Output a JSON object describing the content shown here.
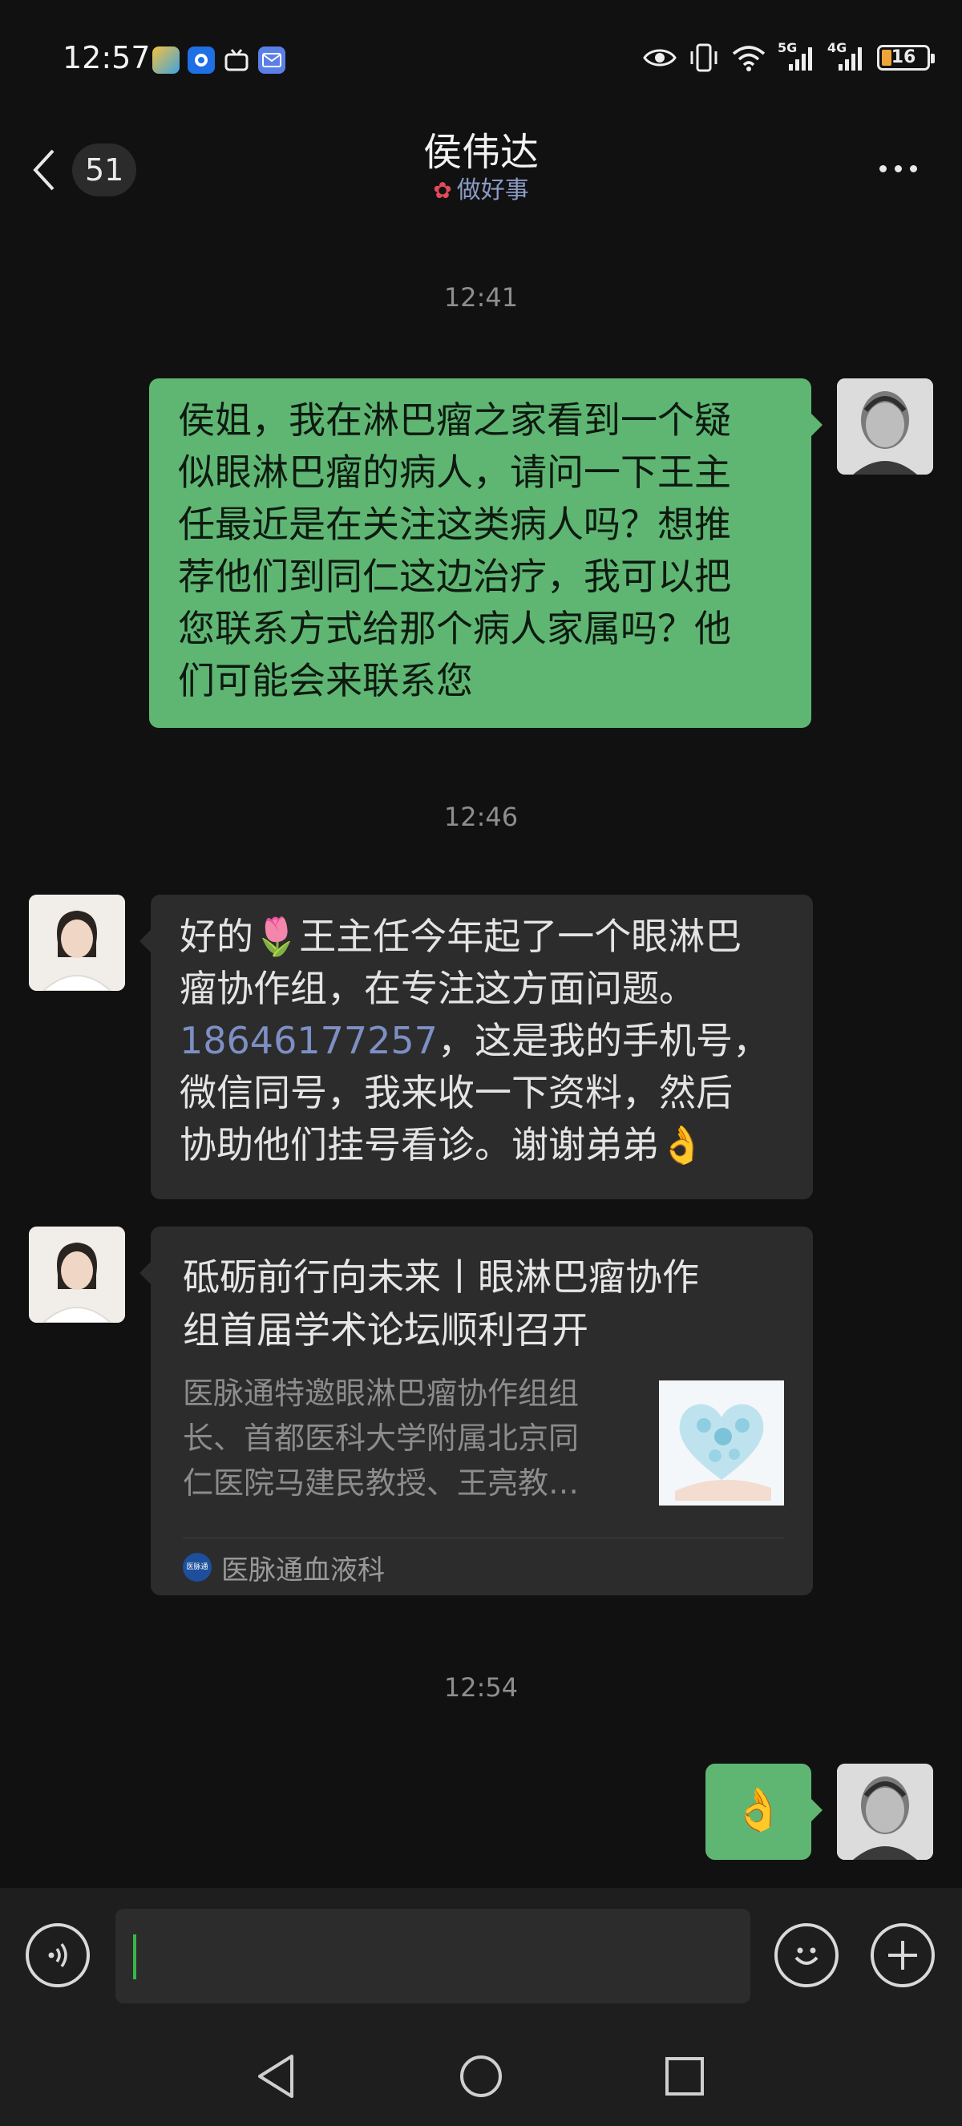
{
  "status_bar": {
    "time": "12:57",
    "battery_level": "16",
    "network_labels": [
      "5G",
      "4G"
    ],
    "icons": [
      "weather-app-icon",
      "browser-app-icon",
      "bilibili-app-icon",
      "mail-app-icon",
      "eye-icon",
      "vibrate-icon",
      "wifi-icon",
      "signal-5g-icon",
      "signal-4g-icon",
      "battery-icon"
    ]
  },
  "header": {
    "unread_count": "51",
    "contact_name": "侯伟达",
    "status_text": "做好事",
    "status_icon": "flower-icon"
  },
  "messages": [
    {
      "type": "timestamp",
      "text": "12:41"
    },
    {
      "type": "text",
      "sender": "self",
      "lines": [
        "侯姐，我在淋巴瘤之家看到一个疑",
        "似眼淋巴瘤的病人，请问一下王主",
        "任最近是在关注这类病人吗？想推",
        "荐他们到同仁这边治疗，我可以把",
        "您联系方式给那个病人家属吗？他",
        "们可能会来联系您"
      ]
    },
    {
      "type": "timestamp",
      "text": "12:46"
    },
    {
      "type": "text",
      "sender": "other",
      "line1_start": "好的",
      "line1_emoji": "🌷",
      "line1_end": "王主任今年起了一个眼淋巴",
      "line2": "瘤协作组，在专注这方面问题。",
      "phone": "18646177257",
      "line3_end": "，这是我的手机号，",
      "line4": "微信同号，我来收一下资料，然后",
      "line5": "协助他们挂号看诊。谢谢弟弟",
      "line5_emoji": "👌"
    },
    {
      "type": "link_card",
      "sender": "other",
      "title_lines": [
        "砥砺前行向未来丨眼淋巴瘤协作",
        "组首届学术论坛顺利召开"
      ],
      "desc_lines": [
        "医脉通特邀眼淋巴瘤协作组组",
        "长、首都医科大学附属北京同",
        "仁医院马建民教授、王亮教…"
      ],
      "source": "医脉通血液科",
      "source_logo_text": "医脉通"
    },
    {
      "type": "timestamp",
      "text": "12:54"
    },
    {
      "type": "emoji",
      "sender": "self",
      "text": "👌"
    }
  ],
  "input_bar": {
    "value": "",
    "voice_icon": "voice-icon",
    "emoji_icon": "emoji-icon",
    "plus_icon": "plus-icon"
  },
  "nav_bar": [
    "back-nav-icon",
    "home-nav-icon",
    "recents-nav-icon"
  ],
  "colors": {
    "background": "#111111",
    "self_bubble": "#5fb673",
    "other_bubble": "#2c2c2c",
    "link": "#7d8fc4",
    "caret": "#39b54a"
  }
}
